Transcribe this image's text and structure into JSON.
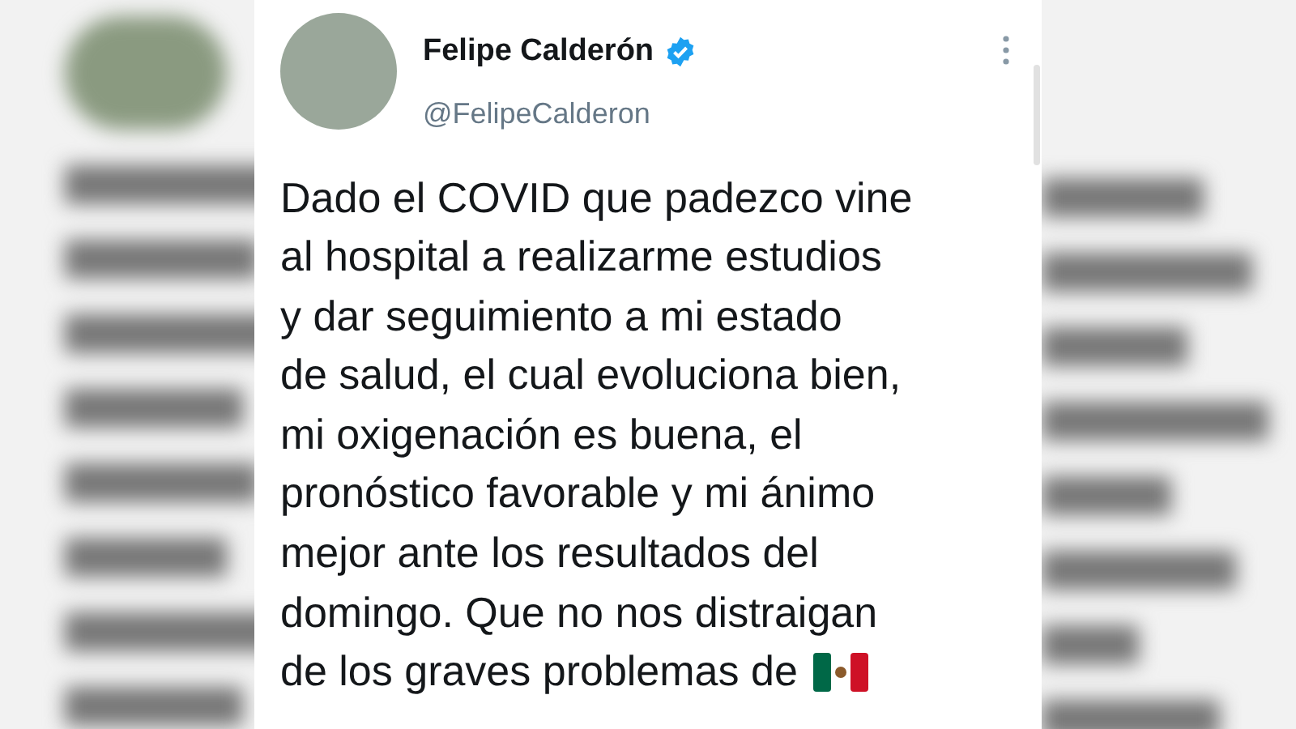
{
  "tweet": {
    "author_name": "Felipe Calderón",
    "verified": true,
    "handle": "@FelipeCalderon",
    "lines": [
      "Dado el COVID que padezco vine",
      "al hospital a realizarme estudios",
      "y dar seguimiento a mi estado",
      "de salud, el cual evoluciona bien,",
      "mi oxigenación es buena, el",
      "pronóstico favorable y mi ánimo",
      "mejor ante los resultados del",
      "domingo. Que no nos distraigan",
      "de los graves problemas de"
    ]
  }
}
